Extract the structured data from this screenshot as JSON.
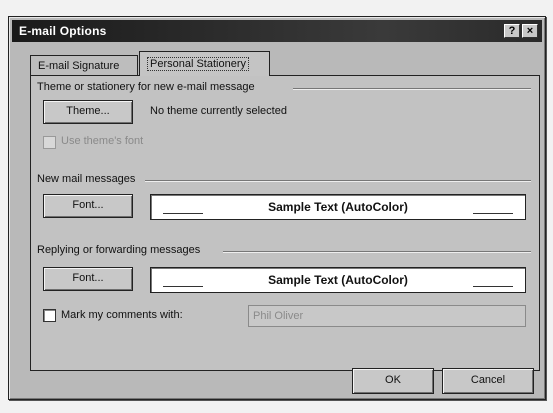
{
  "window": {
    "title": "E-mail Options",
    "help_button": "?",
    "close_button": "×"
  },
  "tabs": [
    {
      "label": "E-mail Signature",
      "selected": false
    },
    {
      "label": "Personal Stationery",
      "selected": true
    }
  ],
  "theme_section": {
    "heading": "Theme or stationery for new e-mail message",
    "theme_button": "Theme...",
    "status_text": "No theme currently selected",
    "use_theme_font_label": "Use theme's font",
    "use_theme_font_checked": false,
    "use_theme_font_enabled": false
  },
  "new_mail_section": {
    "heading": "New mail messages",
    "font_button": "Font...",
    "sample_text": "Sample Text (AutoColor)"
  },
  "reply_section": {
    "heading": "Replying or forwarding messages",
    "font_button": "Font...",
    "sample_text": "Sample Text (AutoColor)",
    "mark_comments_label": "Mark my comments with:",
    "mark_comments_checked": false,
    "comment_name_value": "Phil Oliver",
    "comment_name_enabled": false
  },
  "footer": {
    "ok_label": "OK",
    "cancel_label": "Cancel"
  }
}
